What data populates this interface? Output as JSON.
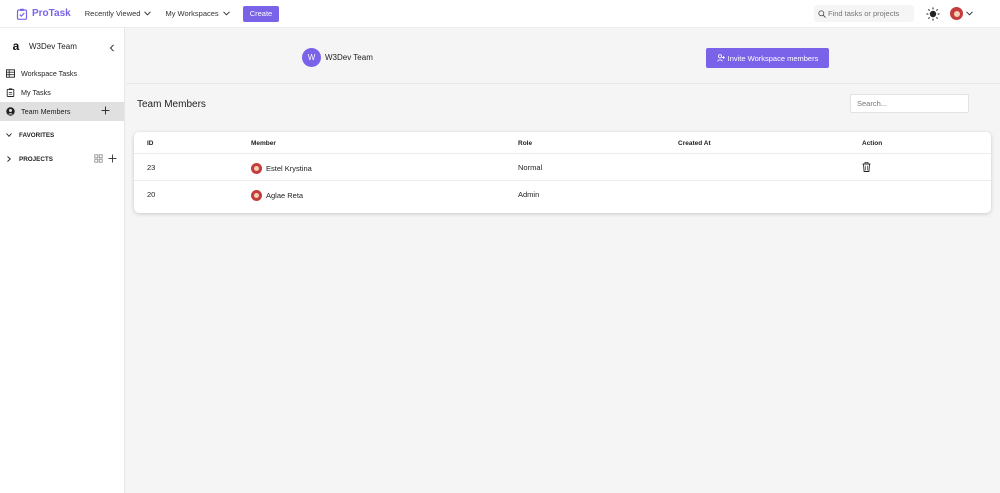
{
  "app": {
    "name": "ProTask",
    "brand_color": "#7b63e9"
  },
  "topbar": {
    "recently_viewed": "Recently Viewed",
    "my_workspaces": "My Workspaces",
    "create_label": "Create",
    "search_placeholder": "Find tasks or projects"
  },
  "sidebar": {
    "workspace_name": "W3Dev Team",
    "workspace_logo": "a",
    "items": [
      {
        "label": "Workspace Tasks",
        "icon": "table-icon"
      },
      {
        "label": "My Tasks",
        "icon": "clipboard-icon"
      },
      {
        "label": "Team Members",
        "icon": "user-circle-icon",
        "active": true
      }
    ],
    "favorites_label": "FAVORITES",
    "projects_label": "PROJECTS"
  },
  "workspace": {
    "avatar_letter": "W",
    "title": "W3Dev Team",
    "invite_label": "Invite Workspace members"
  },
  "members": {
    "title": "Team Members",
    "search_placeholder": "Search...",
    "columns": [
      "ID",
      "Member",
      "Role",
      "Created At",
      "Action"
    ],
    "rows": [
      {
        "id": "23",
        "member": "Estel Krystina",
        "role": "Normal",
        "created_at": ""
      },
      {
        "id": "20",
        "member": "Aglae Reta",
        "role": "Admin",
        "created_at": ""
      }
    ]
  }
}
